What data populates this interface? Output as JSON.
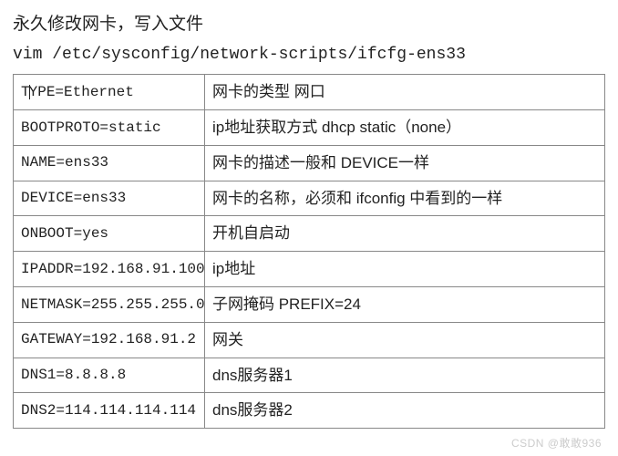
{
  "header": {
    "title": "永久修改网卡，写入文件",
    "command": "vim  /etc/sysconfig/network-scripts/ifcfg-ens33"
  },
  "table": {
    "rows": [
      {
        "config": "TYPE=Ethernet",
        "desc": "网卡的类型 网口"
      },
      {
        "config": "BOOTPROTO=static",
        "desc": "ip地址获取方式  dhcp    static（none）"
      },
      {
        "config": "NAME=ens33",
        "desc": "网卡的描述一般和 DEVICE一样"
      },
      {
        "config": "DEVICE=ens33",
        "desc": "网卡的名称，必须和 ifconfig 中看到的一样"
      },
      {
        "config": "ONBOOT=yes",
        "desc": "开机自启动"
      },
      {
        "config": "IPADDR=192.168.91.100",
        "desc": "ip地址"
      },
      {
        "config": "NETMASK=255.255.255.0",
        "desc": "子网掩码   PREFIX=24"
      },
      {
        "config": "GATEWAY=192.168.91.2",
        "desc": "网关"
      },
      {
        "config": "DNS1=8.8.8.8",
        "desc": "dns服务器1"
      },
      {
        "config": "DNS2=114.114.114.114",
        "desc": "dns服务器2"
      }
    ]
  },
  "watermark": "CSDN @敢敢936"
}
